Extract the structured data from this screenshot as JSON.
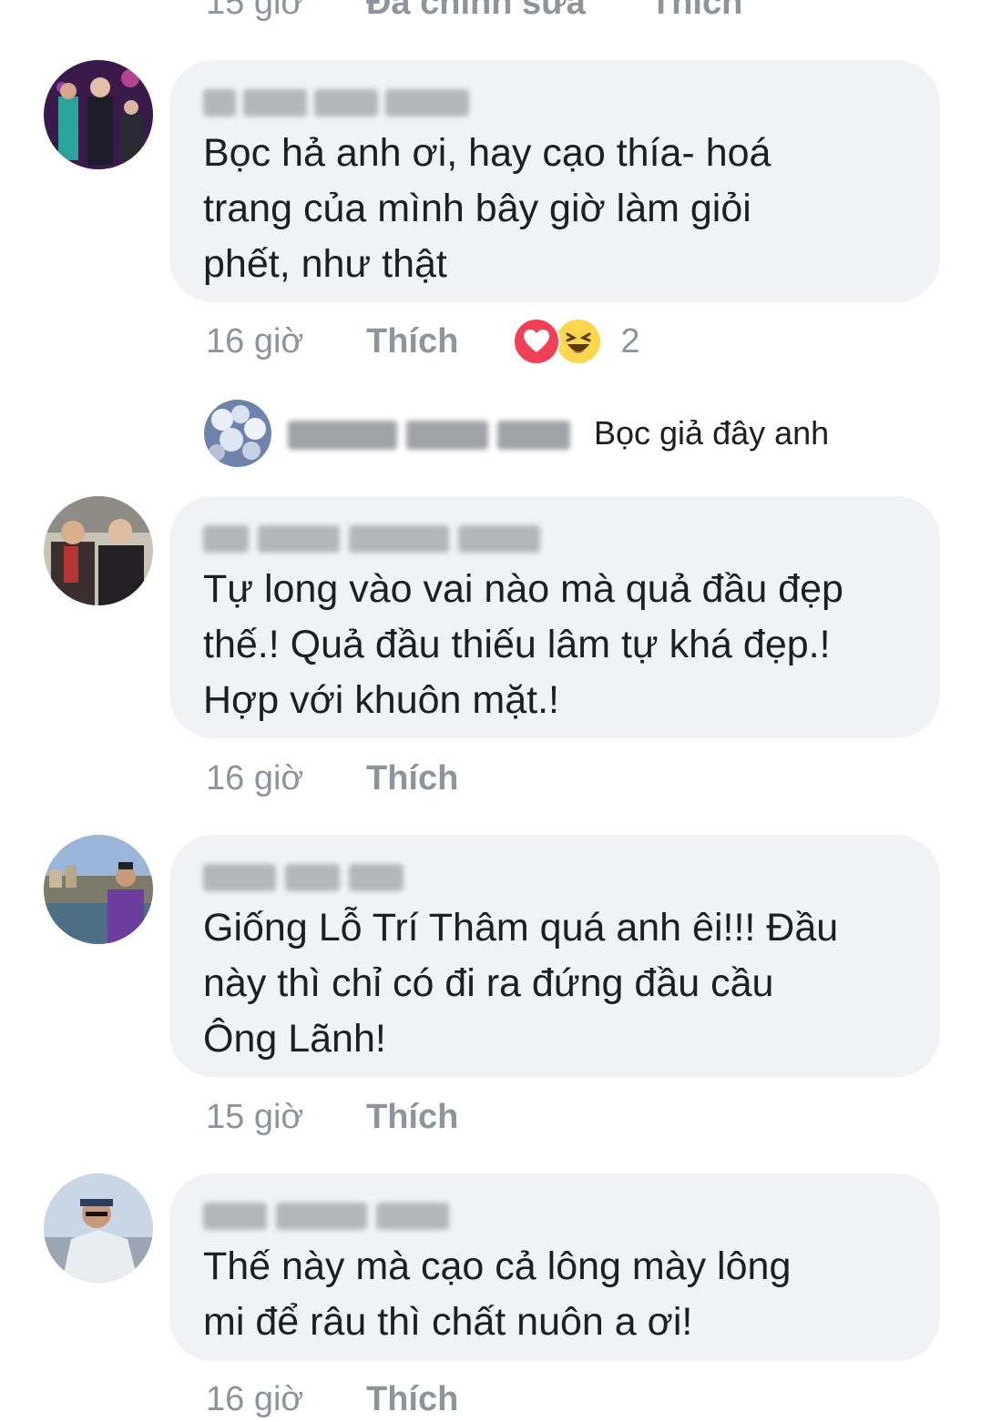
{
  "top_meta": {
    "time": "15 giờ",
    "edited": "Đã chỉnh sửa",
    "like": "Thích"
  },
  "comments": [
    {
      "text": "Bọc hả anh ơi, hay cạo thía- hoá\ntrang của mình bây giờ làm giỏi\nphết, như thật",
      "time": "16 giờ",
      "like": "Thích",
      "reaction_count": "2",
      "reactions": [
        "love-icon",
        "haha-icon"
      ]
    },
    {
      "text": "Tự long vào vai nào mà quả đầu đẹp\nthế.! Quả đầu thiếu lâm tự khá đẹp.!\nHợp với khuôn mặt.!",
      "time": "16 giờ",
      "like": "Thích"
    },
    {
      "text": "Giống Lỗ Trí Thâm quá anh êi!!! Đầu\nnày thì chỉ có đi ra đứng đầu cầu\nÔng Lãnh!",
      "time": "15 giờ",
      "like": "Thích"
    },
    {
      "text": "Thế này mà cạo cả lông mày lông\nmi để râu thì chất nuôn a ơi!",
      "time": "16 giờ",
      "like": "Thích"
    }
  ],
  "reply": {
    "text": "Bọc giả đây anh"
  },
  "colors": {
    "bubble": "#f0f2f5",
    "meta_text": "#8d949e",
    "love": "#f33e58",
    "haha": "#fcd64b"
  }
}
